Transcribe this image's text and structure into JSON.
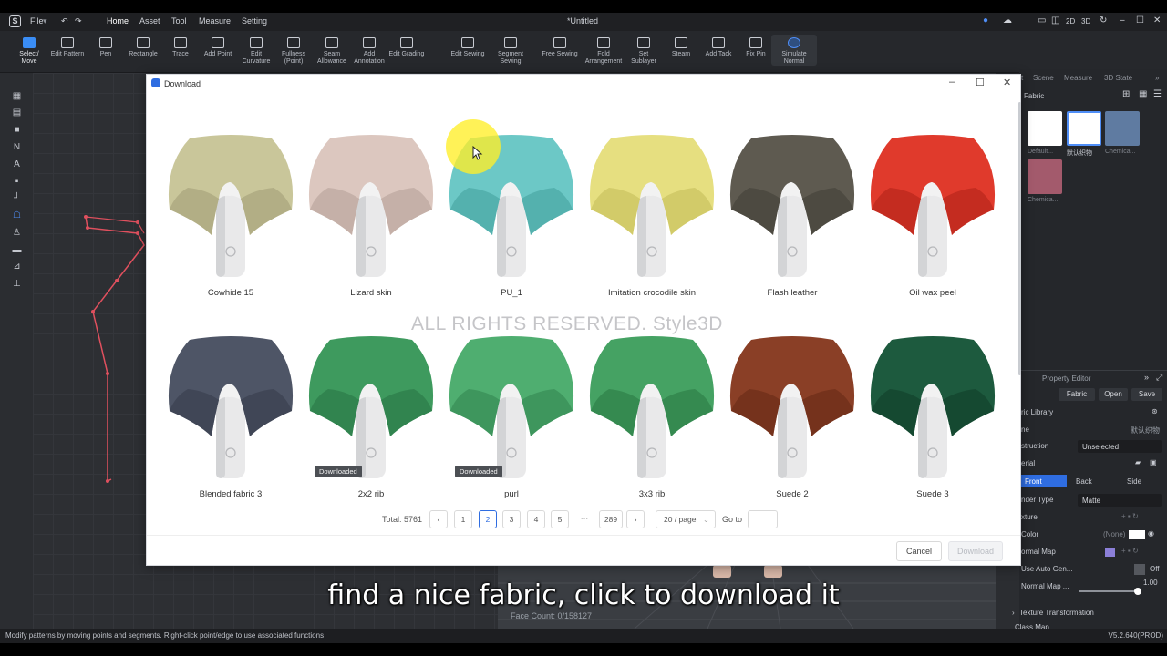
{
  "menubar": {
    "file": "File",
    "tabs": [
      "Home",
      "Asset",
      "Tool",
      "Measure",
      "Setting"
    ],
    "doc_title": "*Untitled",
    "view_2d": "2D",
    "view_3d": "3D"
  },
  "toolbar": {
    "tools": [
      {
        "label": "Select/\nMove",
        "icon": "select-move-icon"
      },
      {
        "label": "Edit Pattern",
        "icon": "edit-pattern-icon"
      },
      {
        "label": "Pen",
        "icon": "pen-icon"
      },
      {
        "label": "Rectangle",
        "icon": "rectangle-icon"
      },
      {
        "label": "Trace",
        "icon": "trace-icon"
      },
      {
        "label": "Add Point",
        "icon": "add-point-icon"
      },
      {
        "label": "Edit\nCurvature",
        "icon": "edit-curvature-icon"
      },
      {
        "label": "Fullness\n(Point)",
        "icon": "fullness-icon"
      },
      {
        "label": "Seam\nAllowance",
        "icon": "seam-allowance-icon"
      },
      {
        "label": "Add\nAnnotation",
        "icon": "add-annotation-icon"
      },
      {
        "label": "Edit Grading",
        "icon": "edit-grading-icon"
      },
      {
        "label": "Edit Sewing",
        "icon": "edit-sewing-icon"
      },
      {
        "label": "Segment\nSewing",
        "icon": "segment-sewing-icon"
      },
      {
        "label": "Free Sewing",
        "icon": "free-sewing-icon"
      },
      {
        "label": "Fold\nArrangement",
        "icon": "fold-arrangement-icon"
      },
      {
        "label": "Set\nSublayer",
        "icon": "set-sublayer-icon"
      },
      {
        "label": "Steam",
        "icon": "steam-icon"
      },
      {
        "label": "Add Tack",
        "icon": "add-tack-icon"
      },
      {
        "label": "Fix Pin",
        "icon": "fix-pin-icon"
      },
      {
        "label": "Simulate\nNormal",
        "icon": "simulate-icon"
      }
    ]
  },
  "right_panel": {
    "tabs": [
      "t",
      "Scene",
      "Measure",
      "3D State"
    ],
    "fabric_header": "Fabric",
    "swatches": [
      {
        "label": "Default...",
        "color": "#ffffff"
      },
      {
        "label": "默认织物",
        "color": "#ffffff"
      },
      {
        "label": "Chemica...",
        "color": "#5f7ba1"
      },
      {
        "label": "Chemica...",
        "color": "#a35a6c"
      }
    ],
    "property_editor": {
      "title": "Property Editor",
      "tab_fabric": "Fabric",
      "open": "Open",
      "save": "Save",
      "library_label": "ric Library",
      "name_label": "ne",
      "name_value": "默认织物",
      "construction_label": "struction",
      "construction_value": "Unselected",
      "material_label": "erial",
      "face_tabs": [
        "Front",
        "Back",
        "Side"
      ],
      "render_type_label": "nder Type",
      "render_type_value": "Matte",
      "texture_label": "xture",
      "color_label": "Color",
      "color_value": "(None)",
      "normal_map_label": "ormal Map",
      "use_auto_gen_label": "Use Auto Gen...",
      "use_auto_gen_value": "Off",
      "normal_map2_label": "Normal Map ...",
      "normal_map2_value": "1.00",
      "texture_transform_label": "Texture Transformation",
      "class_map_label": "Class Map"
    }
  },
  "dialog": {
    "title": "Download",
    "watermark": "ALL RIGHTS RESERVED.  Style3D",
    "fabrics": [
      {
        "name": "Cowhide 15",
        "color": "#c9c69a",
        "shade": "#a8a47c",
        "downloaded": false
      },
      {
        "name": "Lizard skin",
        "color": "#dcc7bf",
        "shade": "#bba69e",
        "downloaded": false
      },
      {
        "name": "PU_1",
        "color": "#6cc8c6",
        "shade": "#4aa6a4",
        "downloaded": false
      },
      {
        "name": "Imitation crocodile skin",
        "color": "#e6df80",
        "shade": "#c9c25f",
        "downloaded": false
      },
      {
        "name": "Flash leather",
        "color": "#5e5a50",
        "shade": "#46433b",
        "downloaded": false
      },
      {
        "name": "Oil wax peel",
        "color": "#e03a2c",
        "shade": "#b8261b",
        "downloaded": false
      },
      {
        "name": "Blended fabric 3",
        "color": "#4e5566",
        "shade": "#3a4050",
        "downloaded": false
      },
      {
        "name": "2x2 rib",
        "color": "#3e9a5e",
        "shade": "#2c7a48",
        "downloaded": true
      },
      {
        "name": "purl",
        "color": "#4fae70",
        "shade": "#388c55",
        "downloaded": true
      },
      {
        "name": "3x3 rib",
        "color": "#45a263",
        "shade": "#2f8049",
        "downloaded": false
      },
      {
        "name": "Suede 2",
        "color": "#8a3f26",
        "shade": "#6c2d18",
        "downloaded": false
      },
      {
        "name": "Suede 3",
        "color": "#1d5a3e",
        "shade": "#12412c",
        "downloaded": false
      }
    ],
    "badge_text": "Downloaded",
    "pager": {
      "total_label": "Total: 5761",
      "pages": [
        "1",
        "2",
        "3",
        "4",
        "5",
        "···",
        "289"
      ],
      "active_page": "2",
      "per_page": "20 / page",
      "goto_label": "Go to"
    },
    "cancel": "Cancel",
    "download": "Download"
  },
  "status_bar": {
    "message": "Modify patterns by moving points and segments. Right-click point/edge to use associated functions",
    "version": "V5.2.640(PROD)",
    "face_count": "Face Count: 0/158127"
  },
  "subtitle": "find a nice fabric, click to download it"
}
